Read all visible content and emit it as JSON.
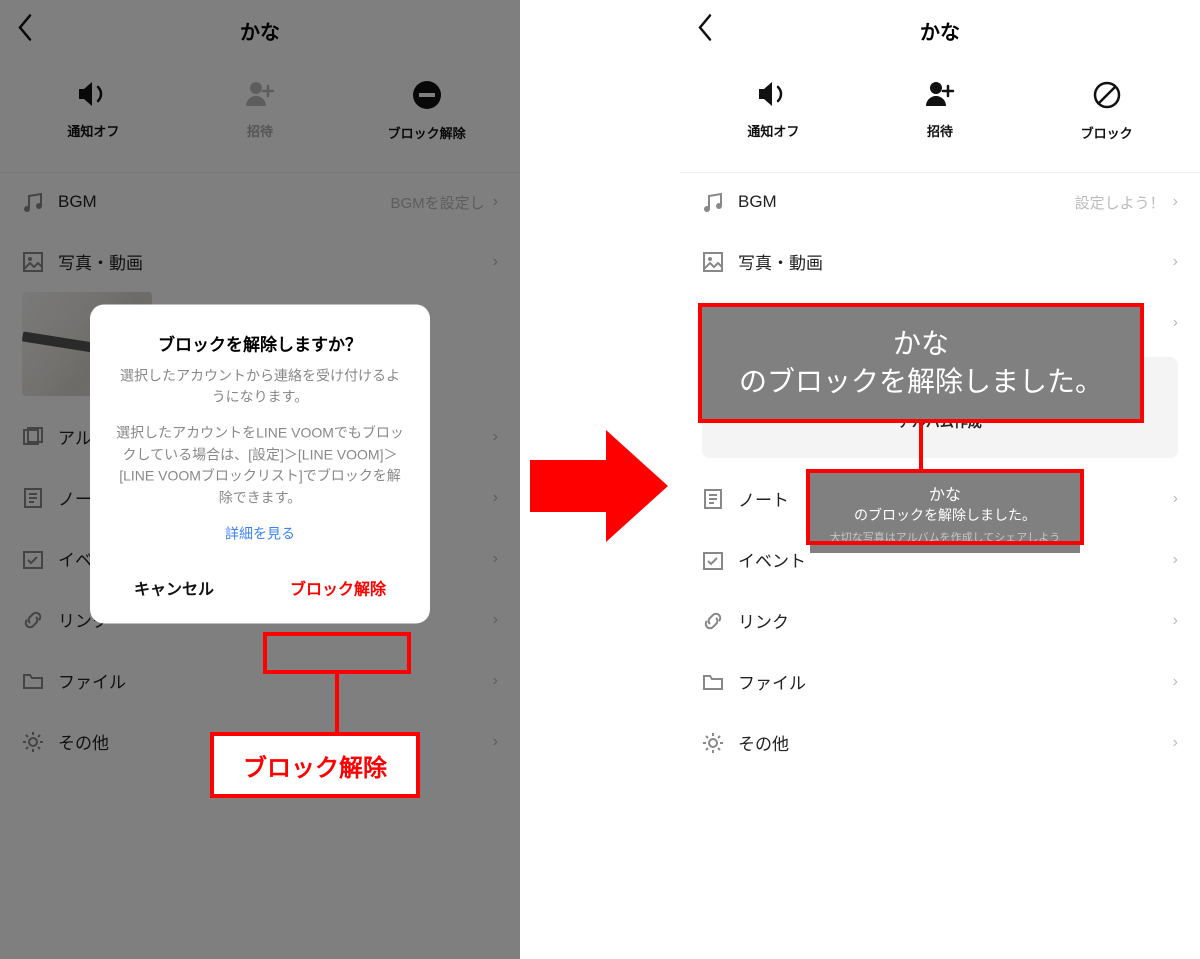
{
  "contact_name": "かな",
  "actions": {
    "mute": {
      "label": "通知オフ"
    },
    "invite": {
      "label": "招待"
    },
    "unblock": {
      "label": "ブロック解除"
    },
    "block": {
      "label": "ブロック"
    }
  },
  "menu": {
    "bgm": {
      "label": "BGM",
      "hint_left": "BGMを設定し",
      "hint_right": "設定しよう！"
    },
    "photos": {
      "label": "写真・動画"
    },
    "albums": {
      "label": "アルバム",
      "ghost": "大切な写真はアルバムを作成してシェアしよう",
      "make": "アルバム作成"
    },
    "notes": {
      "label": "ノート"
    },
    "events": {
      "label": "イベント"
    },
    "links": {
      "label": "リンク"
    },
    "files": {
      "label": "ファイル"
    },
    "other": {
      "label": "その他"
    }
  },
  "dialog": {
    "title": "ブロックを解除しますか？",
    "body1": "選択したアカウントから連絡を受け付けるようになります。",
    "body2": "選択したアカウントをLINE VOOMでもブロックしている場合は、[設定]＞[LINE VOOM]＞[LINE VOOMブロックリスト]でブロックを解除できます。",
    "link": "詳細を見る",
    "cancel": "キャンセル",
    "confirm": "ブロック解除"
  },
  "callout_left": "ブロック解除",
  "toast": {
    "line1": "かな",
    "line2": "のブロックを解除しました。",
    "ghost": "大切な写真はアルバムを作成してシェアしよう"
  }
}
